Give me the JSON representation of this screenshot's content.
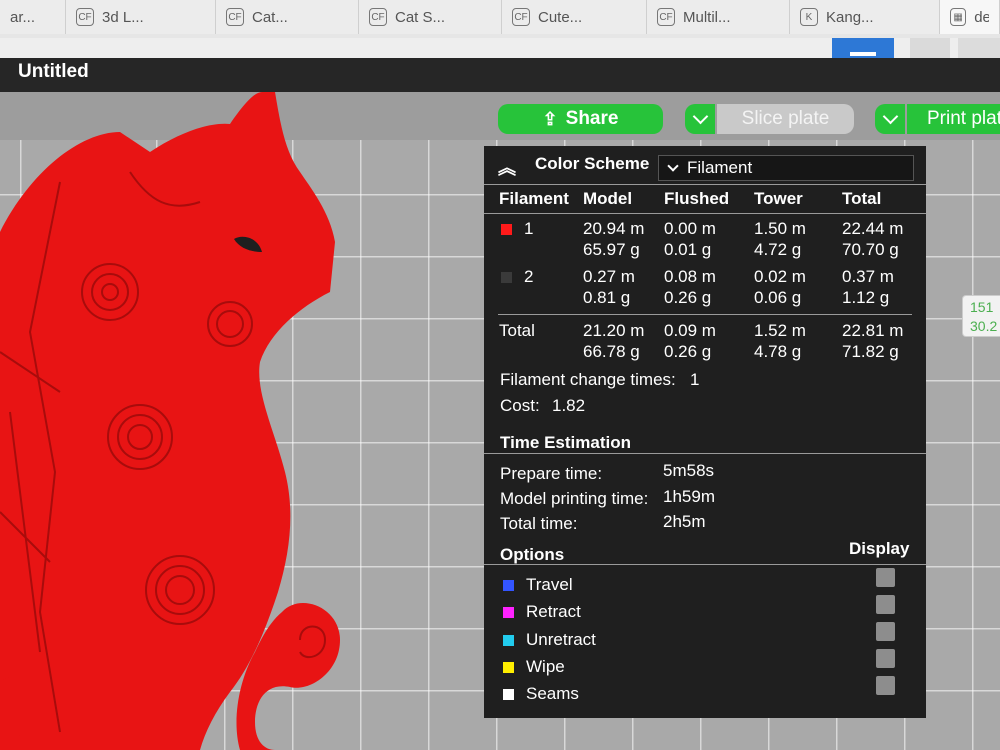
{
  "browser_tabs": [
    {
      "label": "ar...",
      "icon": "app-icon"
    },
    {
      "label": "3d L...",
      "icon": "cf-icon"
    },
    {
      "label": "Cat...",
      "icon": "cf-icon"
    },
    {
      "label": "Cat S...",
      "icon": "cf-icon"
    },
    {
      "label": "Cute...",
      "icon": "cf-icon"
    },
    {
      "label": "Multil...",
      "icon": "cf-icon"
    },
    {
      "label": "Kang...",
      "icon": "kangaroo-icon"
    },
    {
      "label": "de",
      "icon": "grid-icon"
    }
  ],
  "app": {
    "title": "Untitled"
  },
  "actions": {
    "share": "Share",
    "slice": "Slice plate",
    "print": "Print plate"
  },
  "edge_label": {
    "line1": "151",
    "line2": "30.2"
  },
  "stats": {
    "color_scheme_label": "Color Scheme",
    "color_scheme_value": "Filament",
    "columns": [
      "Filament",
      "Model",
      "Flushed",
      "Tower",
      "Total"
    ],
    "filaments": [
      {
        "id": "1",
        "color": "#ff1a1a",
        "model": [
          "20.94 m",
          "65.97 g"
        ],
        "flushed": [
          "0.00 m",
          "0.01 g"
        ],
        "tower": [
          "1.50 m",
          "4.72 g"
        ],
        "total": [
          "22.44 m",
          "70.70 g"
        ]
      },
      {
        "id": "2",
        "color": "#3a3a3a",
        "model": [
          "0.27 m",
          "0.81 g"
        ],
        "flushed": [
          "0.08 m",
          "0.26 g"
        ],
        "tower": [
          "0.02 m",
          "0.06 g"
        ],
        "total": [
          "0.37 m",
          "1.12 g"
        ]
      }
    ],
    "total": {
      "label": "Total",
      "model": [
        "21.20 m",
        "66.78 g"
      ],
      "flushed": [
        "0.09 m",
        "0.26 g"
      ],
      "tower": [
        "1.52 m",
        "4.78 g"
      ],
      "total": [
        "22.81 m",
        "71.82 g"
      ]
    },
    "filament_change_label": "Filament change times:",
    "filament_change_value": "1",
    "cost_label": "Cost:",
    "cost_value": "1.82"
  },
  "time_estimation": {
    "heading": "Time Estimation",
    "rows": [
      {
        "label": "Prepare time:",
        "value": "5m58s"
      },
      {
        "label": "Model printing time:",
        "value": "1h59m"
      },
      {
        "label": "Total time:",
        "value": "2h5m"
      }
    ]
  },
  "options": {
    "heading": "Options",
    "display_label": "Display",
    "items": [
      {
        "label": "Travel",
        "color": "#3355ff"
      },
      {
        "label": "Retract",
        "color": "#ff22ff"
      },
      {
        "label": "Unretract",
        "color": "#22ccee"
      },
      {
        "label": "Wipe",
        "color": "#ffee00"
      },
      {
        "label": "Seams",
        "color": "#ffffff"
      }
    ]
  }
}
